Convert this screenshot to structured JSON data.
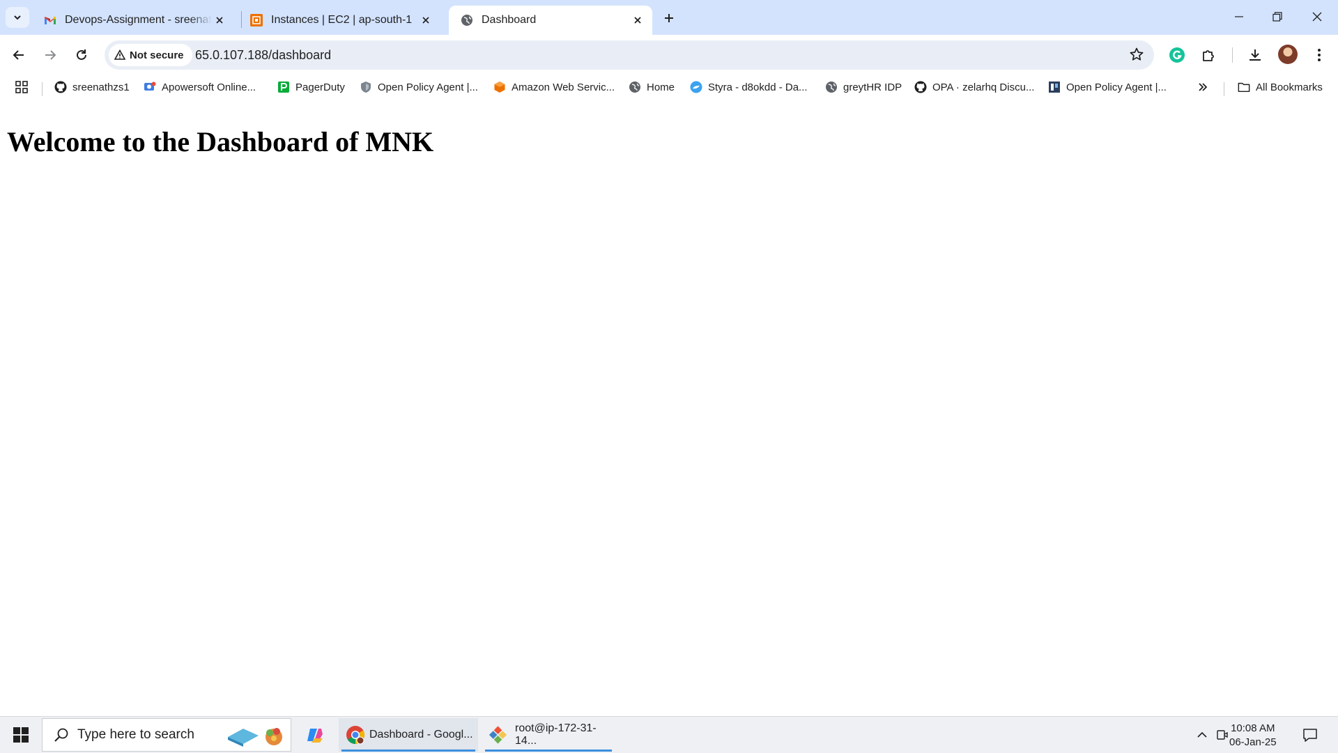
{
  "browser": {
    "tabs": [
      {
        "title": "Devops-Assignment - sreenathl",
        "favicon": "gmail-icon",
        "active": false
      },
      {
        "title": "Instances | EC2 | ap-south-1",
        "favicon": "aws-ec2-icon",
        "active": false
      },
      {
        "title": "Dashboard",
        "favicon": "globe-icon",
        "active": true
      }
    ],
    "address": {
      "security_label": "Not secure",
      "url": "65.0.107.188/dashboard"
    },
    "bookmarks": [
      {
        "label": "sreenathzs1",
        "icon": "github-icon"
      },
      {
        "label": "Apowersoft Online...",
        "icon": "apowersoft-icon"
      },
      {
        "label": "PagerDuty",
        "icon": "pagerduty-icon"
      },
      {
        "label": "Open Policy Agent |...",
        "icon": "opa-icon"
      },
      {
        "label": "Amazon Web Servic...",
        "icon": "aws-icon"
      },
      {
        "label": "Home",
        "icon": "globe-icon"
      },
      {
        "label": "Styra - d8okdd - Da...",
        "icon": "styra-icon"
      },
      {
        "label": "greytHR IDP",
        "icon": "globe-icon"
      },
      {
        "label": "OPA · zelarhq Discu...",
        "icon": "github-icon"
      },
      {
        "label": "Open Policy Agent |...",
        "icon": "opa-logo-icon"
      }
    ],
    "all_bookmarks_label": "All Bookmarks"
  },
  "page": {
    "heading": "Welcome to the Dashboard of MNK"
  },
  "taskbar": {
    "search_placeholder": "Type here to search",
    "apps": [
      {
        "label": "Dashboard - Googl...",
        "icon": "chrome-icon"
      },
      {
        "label": "root@ip-172-31-14...",
        "icon": "git-bash-icon"
      }
    ],
    "time": "10:08 AM",
    "date": "06-Jan-25"
  },
  "colors": {
    "tabstrip": "#d3e3fd",
    "omnibox": "#e9eef6",
    "taskbar": "#eef0f4",
    "accent": "#3b8ede"
  }
}
